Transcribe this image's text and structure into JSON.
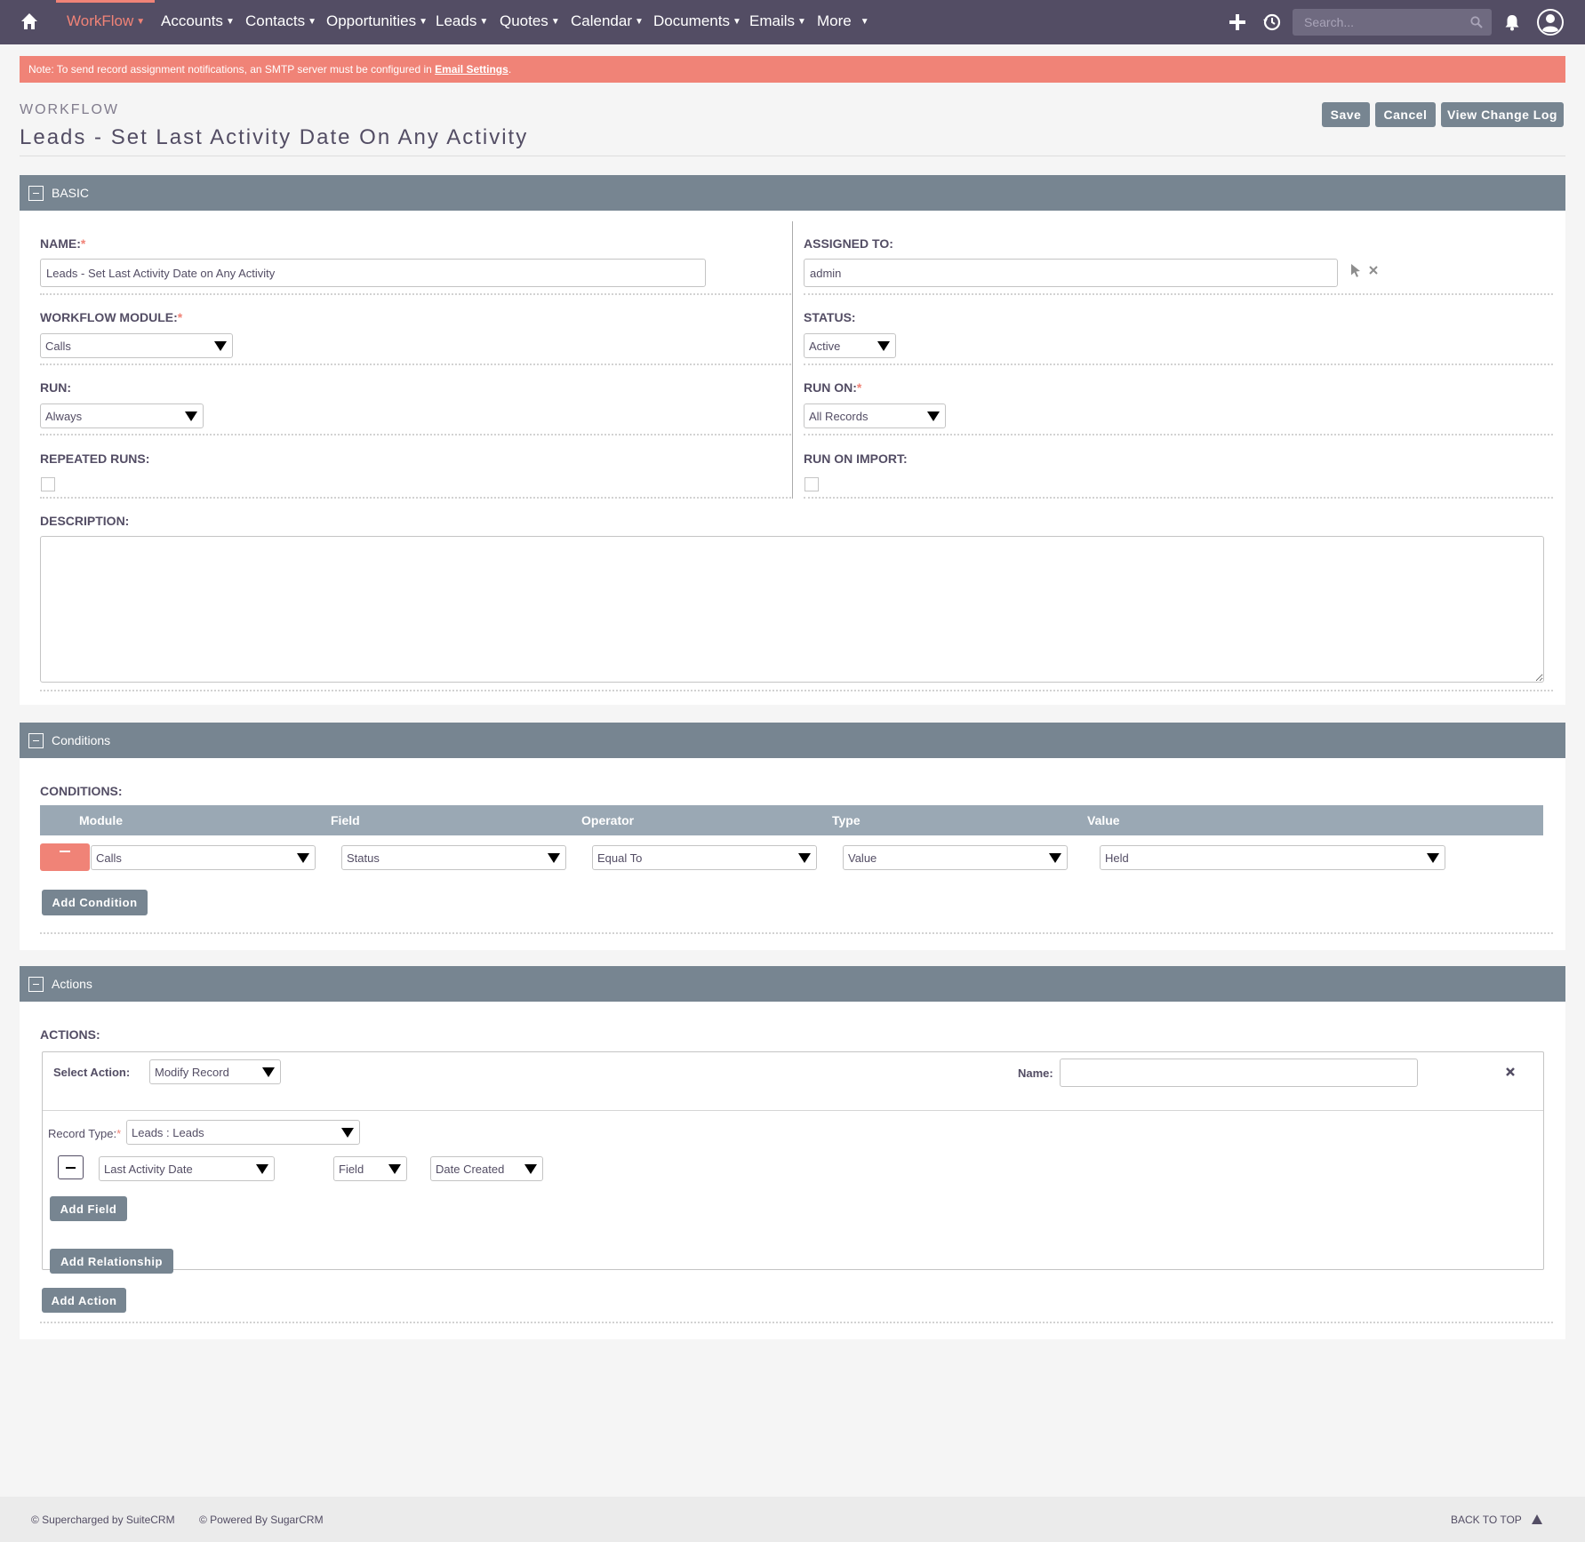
{
  "nav": {
    "items": [
      {
        "label": "WorkFlow",
        "active": true
      },
      {
        "label": "Accounts"
      },
      {
        "label": "Contacts"
      },
      {
        "label": "Opportunities"
      },
      {
        "label": "Leads"
      },
      {
        "label": "Quotes"
      },
      {
        "label": "Calendar"
      },
      {
        "label": "Documents"
      },
      {
        "label": "Emails"
      },
      {
        "label": "More"
      }
    ],
    "search_placeholder": "Search...",
    "icons": [
      "home-icon",
      "plus-icon",
      "history-icon",
      "search-icon",
      "bell-icon",
      "user-avatar-icon"
    ]
  },
  "alert": {
    "text": "Note: To send record assignment notifications, an SMTP server must be configured in ",
    "link": "Email Settings",
    "suffix": "."
  },
  "header": {
    "module": "WORKFLOW",
    "title": "Leads - Set Last Activity Date On Any Activity",
    "buttons": {
      "save": "Save",
      "cancel": "Cancel",
      "changelog": "View Change Log"
    }
  },
  "basic": {
    "title": "BASIC",
    "name_label": "NAME:",
    "name_value": "Leads - Set Last Activity Date on Any Activity",
    "assigned_label": "ASSIGNED TO:",
    "assigned_value": "admin",
    "module_label": "WORKFLOW MODULE:",
    "module_value": "Calls",
    "status_label": "STATUS:",
    "status_value": "Active",
    "run_label": "RUN:",
    "run_value": "Always",
    "runon_label": "RUN ON:",
    "runon_value": "All Records",
    "repeated_label": "REPEATED RUNS:",
    "import_label": "RUN ON IMPORT:",
    "description_label": "DESCRIPTION:",
    "description_value": ""
  },
  "conditions": {
    "title": "Conditions",
    "label": "CONDITIONS:",
    "columns": [
      "Module",
      "Field",
      "Operator",
      "Type",
      "Value"
    ],
    "row": {
      "module": "Calls",
      "field": "Status",
      "operator": "Equal To",
      "type": "Value",
      "value": "Held"
    },
    "add_button": "Add Condition"
  },
  "actions": {
    "title": "Actions",
    "label": "ACTIONS:",
    "select_action_label": "Select Action:",
    "select_action_value": "Modify Record",
    "name_label": "Name:",
    "name_value": "",
    "record_type_label": "Record Type:",
    "record_type_value": "Leads : Leads",
    "field_row": {
      "field": "Last Activity Date",
      "type": "Field",
      "value": "Date Created"
    },
    "add_field": "Add Field",
    "add_relationship": "Add Relationship",
    "add_action": "Add Action"
  },
  "footer": {
    "suitecrm": "© Supercharged by SuiteCRM",
    "sugarcrm": "© Powered By SugarCRM",
    "back_to_top": "BACK TO TOP"
  },
  "colors": {
    "nav_bg": "#534d64",
    "accent": "#f08377",
    "panel_head": "#778591",
    "button": "#778591"
  }
}
